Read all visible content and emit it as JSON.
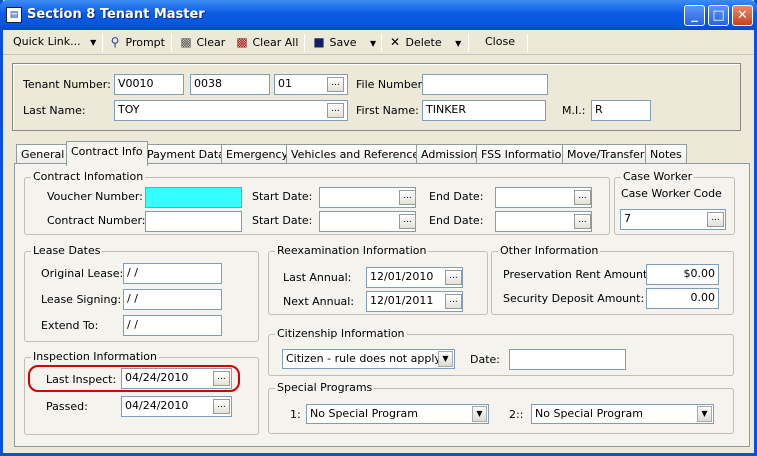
{
  "window": {
    "title": "Section 8 Tenant Master"
  },
  "toolbar": {
    "quick_link": "Quick Link...",
    "prompt": "Prompt",
    "clear": "Clear",
    "clear_all": "Clear All",
    "save": "Save",
    "delete": "Delete",
    "close": "Close"
  },
  "header": {
    "tenant_number_label": "Tenant Number:",
    "tenant_number_1": "V0010",
    "tenant_number_2": "0038",
    "tenant_number_3": "01",
    "file_number_label": "File Number:",
    "file_number": "",
    "last_name_label": "Last Name:",
    "last_name": "TOY",
    "first_name_label": "First Name:",
    "first_name": "TINKER",
    "mi_label": "M.I.:",
    "mi": "R"
  },
  "tabs": [
    "General",
    "Contract Info",
    "Payment Data",
    "Emergency",
    "Vehicles and References",
    "Admission",
    "FSS Information",
    "Move/Transfer",
    "Notes"
  ],
  "contract_info": {
    "title": "Contract Infomation",
    "voucher_label": "Voucher Number:",
    "voucher_value": "",
    "contract_label": "Contract Number:",
    "contract_value": "",
    "start_label": "Start Date:",
    "end_label": "End Date:"
  },
  "case_worker": {
    "title": "Case Worker",
    "code_label": "Case Worker Code",
    "code_value": "7"
  },
  "lease_dates": {
    "title": "Lease Dates",
    "original_label": "Original Lease:",
    "original_value": "/ /",
    "signing_label": "Lease Signing:",
    "signing_value": "/ /",
    "extend_label": "Extend To:",
    "extend_value": "/ /"
  },
  "reexam": {
    "title": "Reexamination Information",
    "last_label": "Last Annual:",
    "last_value": "12/01/2010",
    "next_label": "Next Annual:",
    "next_value": "12/01/2011"
  },
  "other": {
    "title": "Other Information",
    "preservation_label": "Preservation Rent Amount:",
    "preservation_value": "$0.00",
    "deposit_label": "Security Deposit Amount:",
    "deposit_value": "0.00"
  },
  "citizenship": {
    "title": "Citizenship Information",
    "status": "Citizen - rule does not apply",
    "date_label": "Date:",
    "date_value": ""
  },
  "inspection": {
    "title": "Inspection Information",
    "last_label": "Last Inspect:",
    "last_value": "04/24/2010",
    "passed_label": "Passed:",
    "passed_value": "04/24/2010",
    "highlight_color": "#d40000"
  },
  "special": {
    "title": "Special Programs",
    "label1": "1:",
    "program1": "No Special Program",
    "label2": "2::",
    "program2": "No Special Program"
  },
  "colors": {
    "title_bar": "#0b5ce6",
    "voucher_fill": "#33ffff",
    "tab_panel": "#f4f3ee"
  },
  "icons": {
    "ellipsis": "...",
    "dropdown": "▼"
  }
}
